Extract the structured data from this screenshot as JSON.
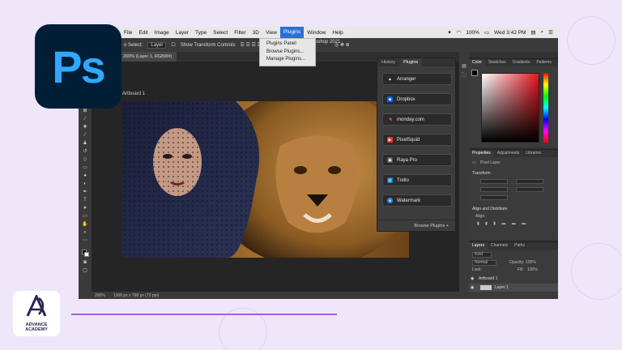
{
  "brand": {
    "ps_logo_text": "Ps",
    "academy_line1": "ADVANCE",
    "academy_line2": "ACADEMY"
  },
  "menubar": {
    "items": [
      "File",
      "Edit",
      "Image",
      "Layer",
      "Type",
      "Select",
      "Filter",
      "3D",
      "View",
      "Plugins",
      "Window",
      "Help"
    ],
    "active": "Plugins",
    "doc_title": "oshop 2021",
    "battery": "100%",
    "clock": "Wed 3:42 PM"
  },
  "plugins_menu": {
    "items": [
      "Plugins Panel",
      "Browse Plugins...",
      "Manage Plugins..."
    ]
  },
  "options_bar": {
    "auto_select_label": "o Select:",
    "auto_select_value": "Layer",
    "transform_controls_label": "Show Transform Controls"
  },
  "document_tab": {
    "label": "200% (Layer 1, RGB/8#)"
  },
  "artboard": {
    "label": "Artboard 1"
  },
  "status_bar": {
    "zoom": "200%",
    "dimensions": "1366 px x 768 px (72 ppi)"
  },
  "plugins_panel": {
    "tabs": [
      "History",
      "Plugins"
    ],
    "active_tab": "Plugins",
    "plugins": [
      {
        "name": "Arranger",
        "icon": "arranger-icon",
        "color": "#3a3a3a"
      },
      {
        "name": "Dropbox",
        "icon": "dropbox-icon",
        "color": "#0061ff"
      },
      {
        "name": "monday.com",
        "icon": "monday-icon",
        "color": "#ff3d57"
      },
      {
        "name": "PixelSquid",
        "icon": "pixelsquid-icon",
        "color": "#e6322e"
      },
      {
        "name": "Raya Pro",
        "icon": "rayapro-icon",
        "color": "#4a4a4a"
      },
      {
        "name": "Trello",
        "icon": "trello-icon",
        "color": "#0079bf"
      },
      {
        "name": "Watermark",
        "icon": "watermark-icon",
        "color": "#2d8cf0"
      }
    ],
    "browse_label": "Browse Plugins"
  },
  "color_panel": {
    "tabs": [
      "Color",
      "Swatches",
      "Gradients",
      "Patterns"
    ],
    "active_tab": "Color"
  },
  "properties_panel": {
    "tabs": [
      "Properties",
      "Adjustments",
      "Libraries"
    ],
    "active_tab": "Properties",
    "layer_type": "Pixel Layer",
    "transform_label": "Transform",
    "align_label": "Align and Distribute",
    "align_sub": "Align:"
  },
  "layers_panel": {
    "tabs": [
      "Layers",
      "Channels",
      "Paths"
    ],
    "active_tab": "Layers",
    "filter": "Kind",
    "blend_mode": "Normal",
    "opacity_label": "Opacity:",
    "opacity": "100%",
    "lock_label": "Lock:",
    "fill_label": "Fill:",
    "fill": "100%",
    "layers": [
      "Artboard 1",
      "Layer 1"
    ]
  }
}
